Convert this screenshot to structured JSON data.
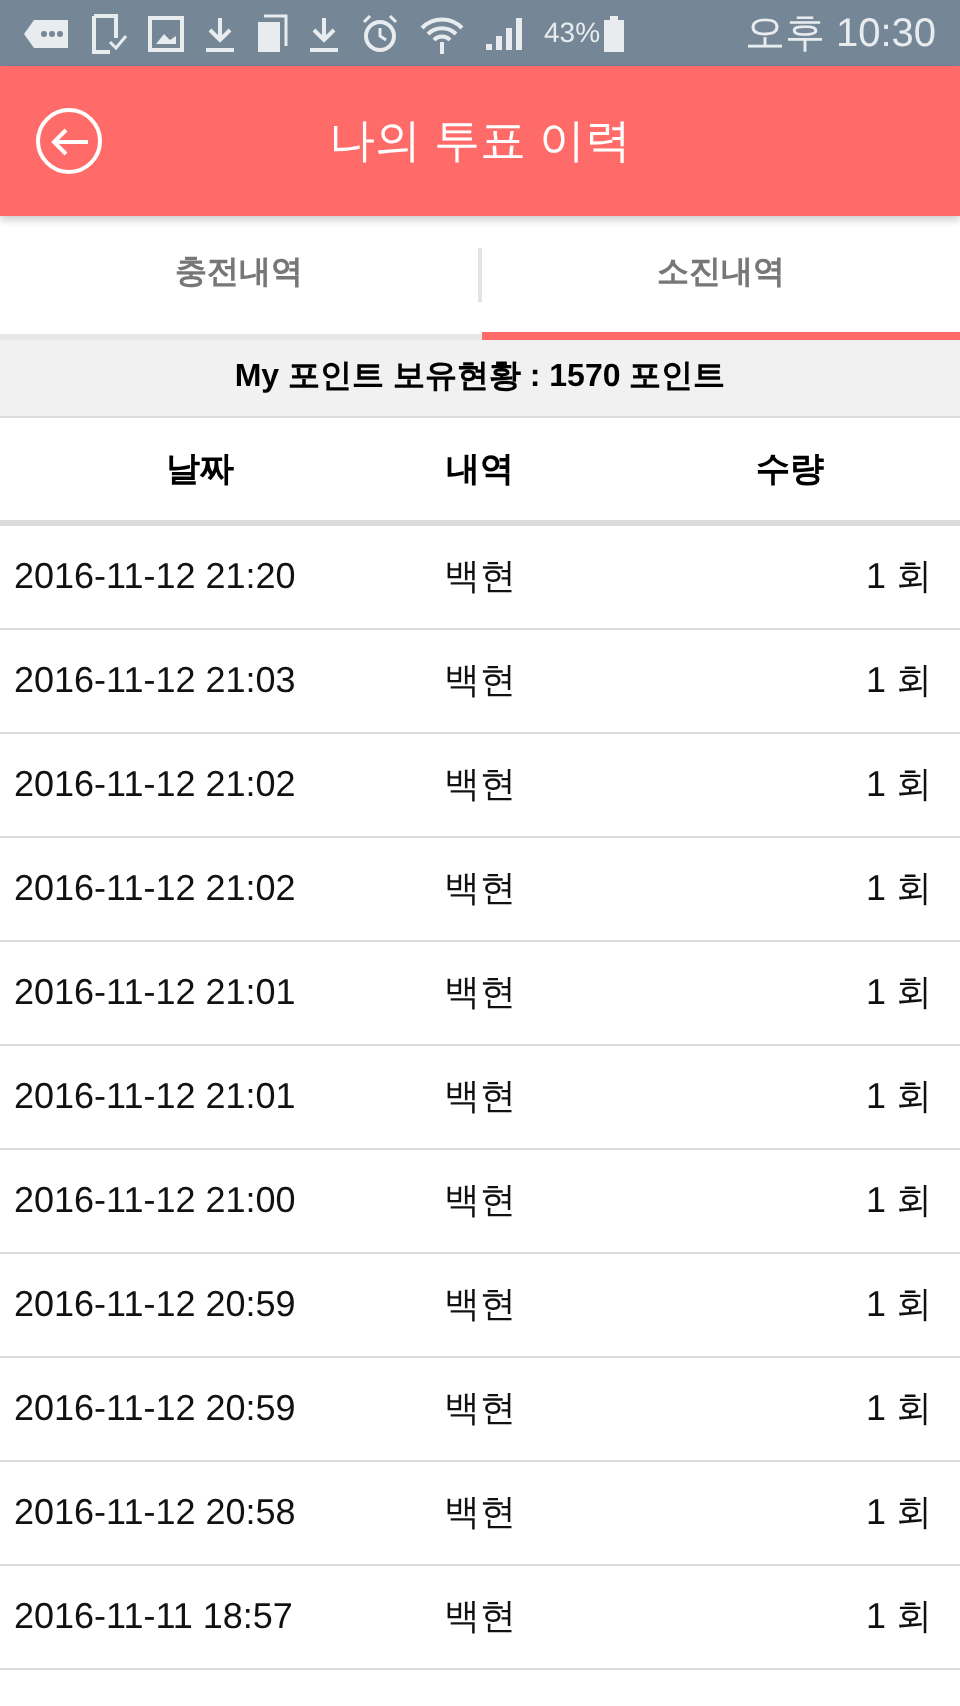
{
  "status_bar": {
    "battery": "43%",
    "time": "오후 10:30"
  },
  "header": {
    "title": "나의 투표 이력"
  },
  "tabs": [
    {
      "label": "충전내역",
      "selected": false
    },
    {
      "label": "소진내역",
      "selected": true
    }
  ],
  "summary": "My 포인트 보유현황 : 1570 포인트",
  "table": {
    "columns": [
      "날짜",
      "내역",
      "수량"
    ],
    "rows": [
      {
        "date": "2016-11-12 21:20",
        "item": "백현",
        "amount": "1 회"
      },
      {
        "date": "2016-11-12 21:03",
        "item": "백현",
        "amount": "1 회"
      },
      {
        "date": "2016-11-12 21:02",
        "item": "백현",
        "amount": "1 회"
      },
      {
        "date": "2016-11-12 21:02",
        "item": "백현",
        "amount": "1 회"
      },
      {
        "date": "2016-11-12 21:01",
        "item": "백현",
        "amount": "1 회"
      },
      {
        "date": "2016-11-12 21:01",
        "item": "백현",
        "amount": "1 회"
      },
      {
        "date": "2016-11-12 21:00",
        "item": "백현",
        "amount": "1 회"
      },
      {
        "date": "2016-11-12 20:59",
        "item": "백현",
        "amount": "1 회"
      },
      {
        "date": "2016-11-12 20:59",
        "item": "백현",
        "amount": "1 회"
      },
      {
        "date": "2016-11-12 20:58",
        "item": "백현",
        "amount": "1 회"
      },
      {
        "date": "2016-11-11 18:57",
        "item": "백현",
        "amount": "1 회"
      }
    ]
  }
}
